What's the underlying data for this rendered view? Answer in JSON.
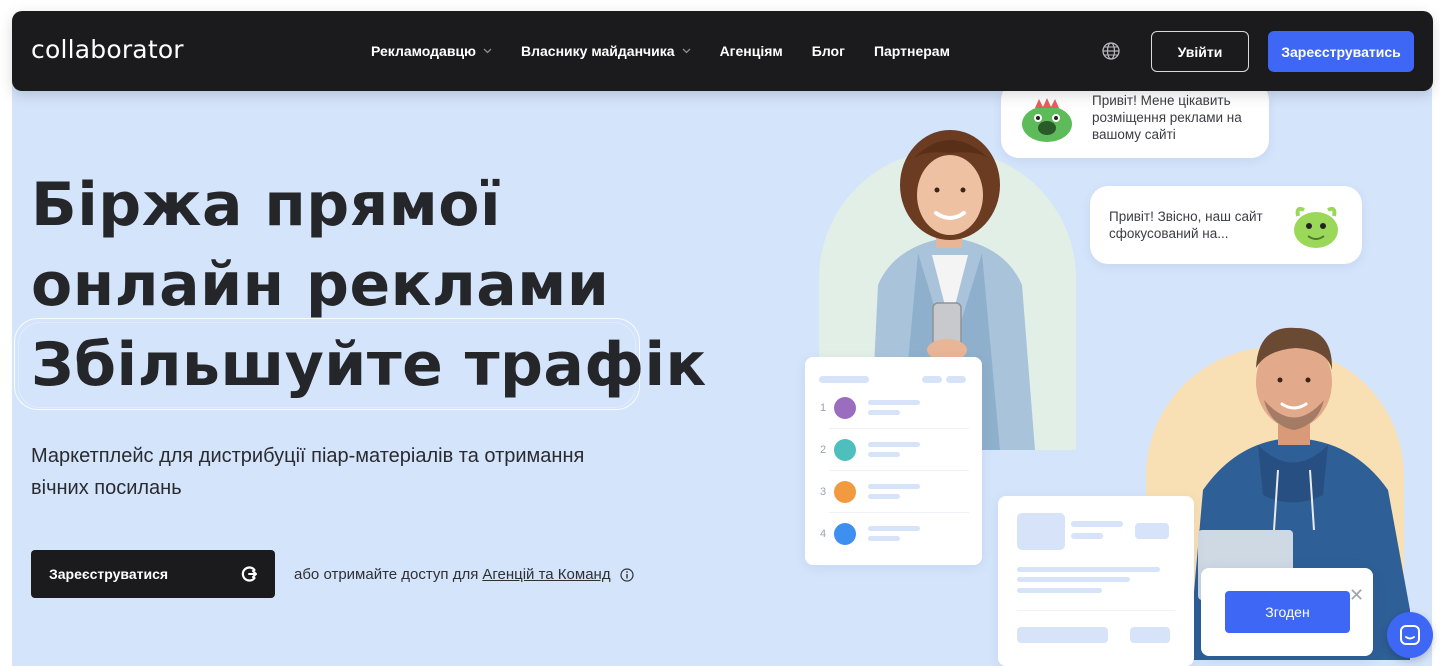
{
  "navbar": {
    "logo": "collaborator",
    "menu": [
      {
        "label": "Рекламодавцю",
        "has_dropdown": true
      },
      {
        "label": "Власнику майданчика",
        "has_dropdown": true
      },
      {
        "label": "Агенціям",
        "has_dropdown": false
      },
      {
        "label": "Блог",
        "has_dropdown": false
      },
      {
        "label": "Партнерам",
        "has_dropdown": false
      }
    ],
    "language_icon": "globe-icon",
    "login_label": "Увійти",
    "register_label": "Зареєструватись"
  },
  "hero": {
    "headline_line1": "Біржа прямої",
    "headline_line2": "онлайн реклами",
    "headline_line3": "Збільшуйте трафік",
    "subtitle": "Маркетплейс для дистрибуції піар-матеріалів та отримання вічних посилань",
    "cta_label": "Зареєструватися",
    "cta_note_prefix": "або отримайте доступ для",
    "cta_note_link": "Агенцій та Команд"
  },
  "illustration": {
    "bubble1_text": "Привіт! Мене цікавить розміщення реклами на вашому сайті",
    "bubble2_text": "Привіт! Звісно, наш сайт сфокусований на...",
    "list_numbers": [
      "1",
      "2",
      "3",
      "4"
    ],
    "list_dot_colors": [
      "#9b6dbf",
      "#4fbfbd",
      "#f29a3f",
      "#3d8ff0"
    ]
  },
  "cookie": {
    "accept_label": "Згоден",
    "close_symbol": "✕"
  },
  "colors": {
    "accent": "#3e67f5",
    "navbar_bg": "#1b1b1d",
    "hero_bg": "#d4e4fb",
    "text_dark": "#25262a"
  }
}
